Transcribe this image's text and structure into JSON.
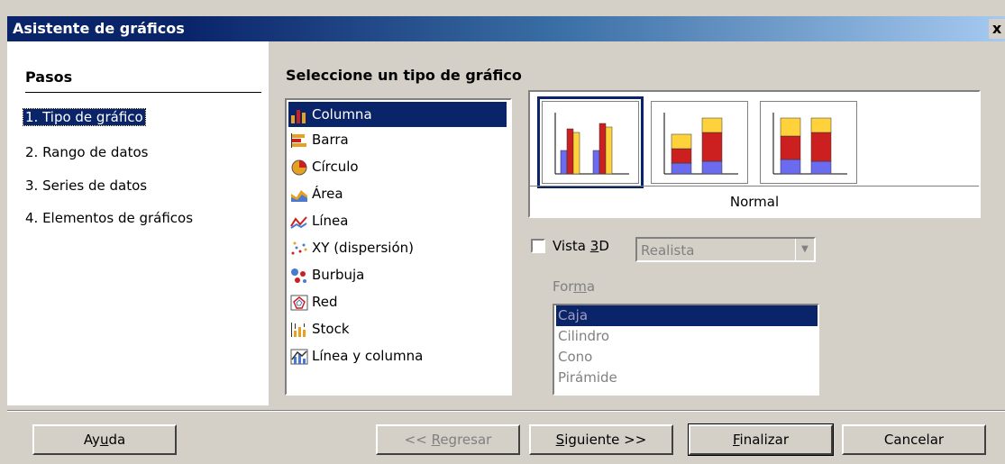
{
  "window": {
    "title": "Asistente de gráficos",
    "close_glyph": "x"
  },
  "steps": {
    "title": "Pasos",
    "items": [
      "1. Tipo de gráfico",
      "2. Rango de datos",
      "3. Series de datos",
      "4. Elementos de gráficos"
    ],
    "selected_index": 0
  },
  "main": {
    "title": "Seleccione un tipo de gráfico",
    "chart_types": [
      {
        "label": "Columna",
        "icon": "column-chart-icon"
      },
      {
        "label": "Barra",
        "icon": "bar-chart-icon"
      },
      {
        "label": "Círculo",
        "icon": "pie-chart-icon"
      },
      {
        "label": "Área",
        "icon": "area-chart-icon"
      },
      {
        "label": "Línea",
        "icon": "line-chart-icon"
      },
      {
        "label": "XY (dispersión)",
        "icon": "scatter-chart-icon"
      },
      {
        "label": "Burbuja",
        "icon": "bubble-chart-icon"
      },
      {
        "label": "Red",
        "icon": "net-chart-icon"
      },
      {
        "label": "Stock",
        "icon": "stock-chart-icon"
      },
      {
        "label": "Línea y columna",
        "icon": "line-column-chart-icon"
      }
    ],
    "selected_type_index": 0,
    "variant_caption": "Normal",
    "vista3d": {
      "label_pre": "Vista ",
      "label_key": "3",
      "label_post": "D",
      "checked": false,
      "combo_value": "Realista"
    },
    "forma": {
      "label_pre": "For",
      "label_key": "m",
      "label_post": "a",
      "options": [
        "Caja",
        "Cilindro",
        "Cono",
        "Pirámide"
      ],
      "selected_index": 0
    }
  },
  "buttons": {
    "help": {
      "pre": "Ay",
      "key": "u",
      "post": "da"
    },
    "back": {
      "pre": "<< ",
      "key": "R",
      "post": "egresar"
    },
    "next": {
      "pre": "",
      "key": "S",
      "post": "iguiente >>"
    },
    "finish": {
      "pre": "",
      "key": "F",
      "post": "inalizar"
    },
    "cancel": {
      "pre": "Cancelar",
      "key": "",
      "post": ""
    }
  },
  "colors": {
    "selection": "#0a246a",
    "bar_blue": "#6b6bf0",
    "bar_red": "#cc1f1f",
    "bar_yellow": "#ffd23c"
  }
}
